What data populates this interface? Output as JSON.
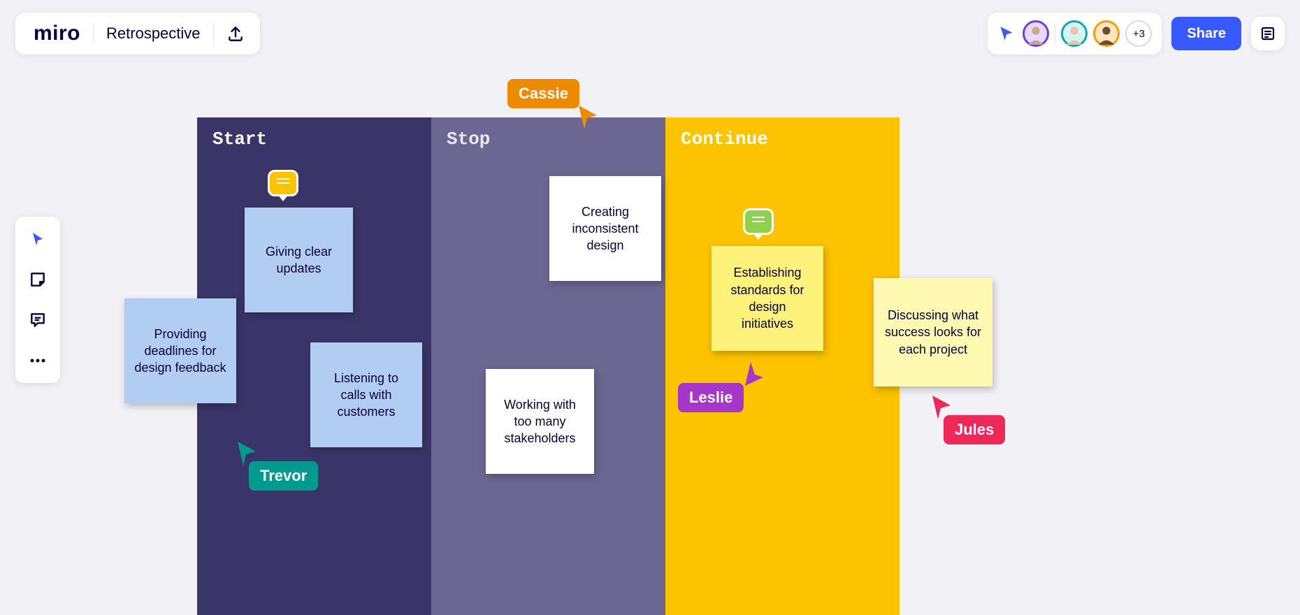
{
  "header": {
    "logo": "miro",
    "board_title": "Retrospective"
  },
  "presence": {
    "plus_count": "+3",
    "share_label": "Share"
  },
  "columns": {
    "start": "Start",
    "stop": "Stop",
    "continue": "Continue"
  },
  "stickies": {
    "s1": "Providing deadlines for design feedback",
    "s2": "Giving clear updates",
    "s3": "Listening to calls with customers",
    "s4": "Creating inconsistent design",
    "s5": "Working with too many stakeholders",
    "s6": "Establishing standards for design initiatives",
    "s7": "Discussing what success looks for each project"
  },
  "cursors": {
    "cassie": "Cassie",
    "trevor": "Trevor",
    "leslie": "Leslie",
    "jules": "Jules"
  }
}
